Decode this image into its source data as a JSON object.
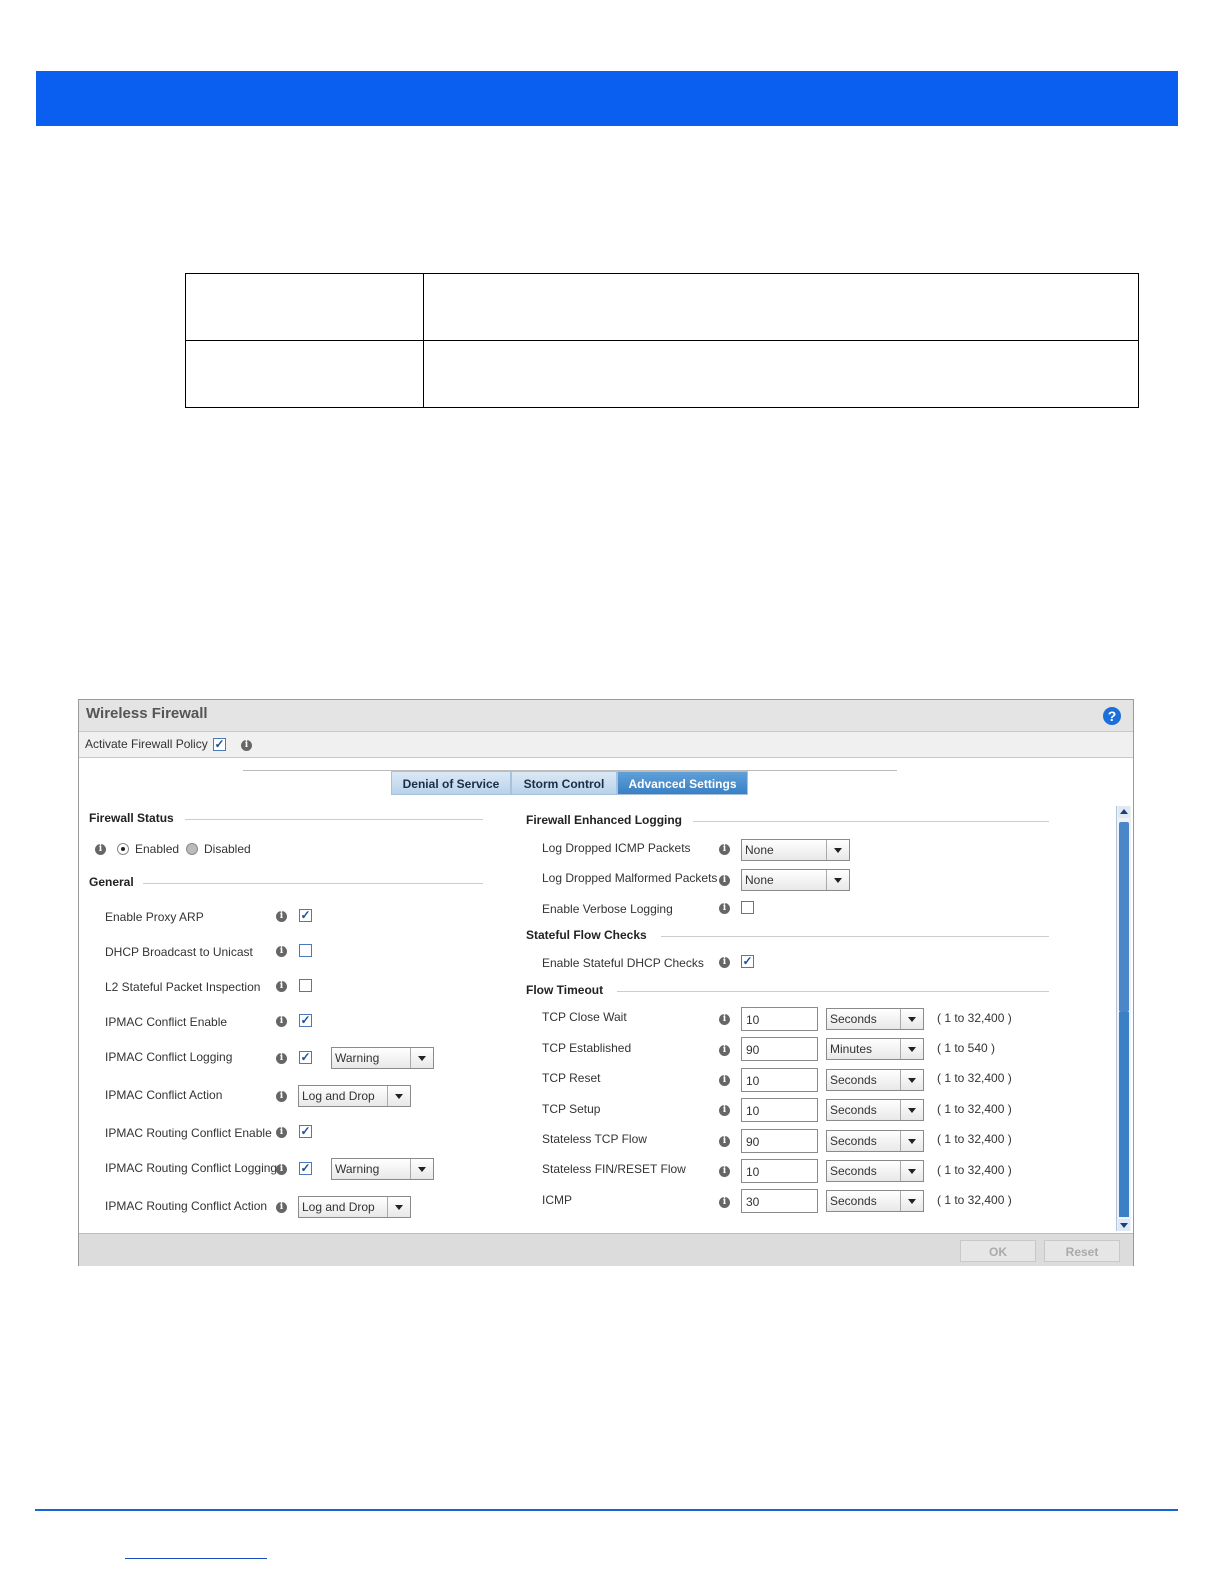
{
  "panel": {
    "title": "Wireless Firewall",
    "activate_label": "Activate Firewall Policy",
    "tabs": [
      "Denial of Service",
      "Storm Control",
      "Advanced Settings"
    ]
  },
  "left": {
    "firewall_status_title": "Firewall Status",
    "enabled_label": "Enabled",
    "disabled_label": "Disabled",
    "general_title": "General",
    "rows": [
      {
        "label": "Enable Proxy ARP",
        "checked": true
      },
      {
        "label": "DHCP Broadcast to Unicast",
        "checked": false
      },
      {
        "label": "L2 Stateful Packet Inspection",
        "checked": false
      },
      {
        "label": "IPMAC Conflict Enable",
        "checked": true
      },
      {
        "label": "IPMAC Conflict Logging",
        "checked": true,
        "select": "Warning"
      },
      {
        "label": "IPMAC Conflict Action",
        "select": "Log and Drop"
      },
      {
        "label": "IPMAC Routing Conflict Enable",
        "checked": true
      },
      {
        "label": "IPMAC Routing Conflict Logging",
        "checked": true,
        "select": "Warning"
      },
      {
        "label": "IPMAC Routing Conflict Action",
        "select": "Log and Drop"
      }
    ]
  },
  "right": {
    "logging_title": "Firewall Enhanced Logging",
    "log_icmp_label": "Log Dropped ICMP Packets",
    "log_icmp_value": "None",
    "log_malformed_label": "Log Dropped Malformed Packets",
    "log_malformed_value": "None",
    "verbose_label": "Enable Verbose Logging",
    "stateful_title": "Stateful Flow Checks",
    "dhcp_checks_label": "Enable Stateful DHCP Checks",
    "timeout_title": "Flow Timeout",
    "timeouts": [
      {
        "label": "TCP Close Wait",
        "value": "10",
        "unit": "Seconds",
        "range": "( 1 to 32,400 )"
      },
      {
        "label": "TCP Established",
        "value": "90",
        "unit": "Minutes",
        "range": "( 1 to 540 )"
      },
      {
        "label": "TCP Reset",
        "value": "10",
        "unit": "Seconds",
        "range": "( 1 to 32,400 )"
      },
      {
        "label": "TCP Setup",
        "value": "10",
        "unit": "Seconds",
        "range": "( 1 to 32,400 )"
      },
      {
        "label": "Stateless TCP Flow",
        "value": "90",
        "unit": "Seconds",
        "range": "( 1 to 32,400 )"
      },
      {
        "label": "Stateless FIN/RESET Flow",
        "value": "10",
        "unit": "Seconds",
        "range": "( 1 to 32,400 )"
      },
      {
        "label": "ICMP",
        "value": "30",
        "unit": "Seconds",
        "range": "( 1 to 32,400 )"
      }
    ]
  },
  "footer": {
    "ok": "OK",
    "reset": "Reset"
  },
  "colors": {
    "banner": "#0a5ff0",
    "rule": "#1566d4",
    "active_tab": "#3a80c4"
  }
}
